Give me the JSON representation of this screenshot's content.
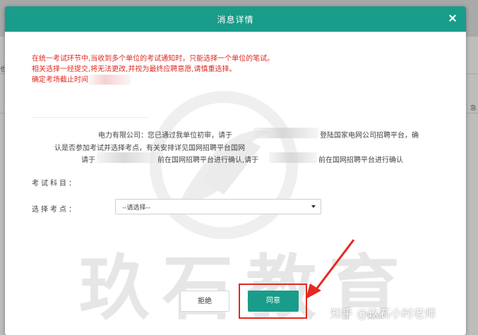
{
  "modal": {
    "title": "消息详情",
    "close": "×"
  },
  "notice": {
    "line1": "在统一考试环节中,当收到多个单位的考试通知时，只能选择一个单位的笔试。",
    "line2": "相关选择一经提交,将无法更改,并视为最终应聘意愿,请慎重选择。",
    "line3": "确定考场截止时间"
  },
  "info": {
    "line1a": "电力有限公司：您已通过我单位初审，请于",
    "line1b": "登陆国家电网公司招聘平台，确",
    "line2": "认是否参加考试并选择考点，有关安排详见国网招聘平台国网",
    "line3a": "请于",
    "line3b": "前在国网招聘平台进行确认,请于",
    "line3c": "前在国网招聘平台进行确认"
  },
  "form": {
    "subject_label": "考试科目：",
    "site_label": "选择考点：",
    "site_value": "--请选择--"
  },
  "buttons": {
    "reject": "拒绝",
    "accept": "同意"
  },
  "watermark": {
    "text": "玖石教育",
    "footer": "知乎 @玖石小时老师"
  },
  "colors": {
    "header": "#1a9c8a",
    "notice": "#e0281f",
    "annotation": "#e22a22"
  }
}
